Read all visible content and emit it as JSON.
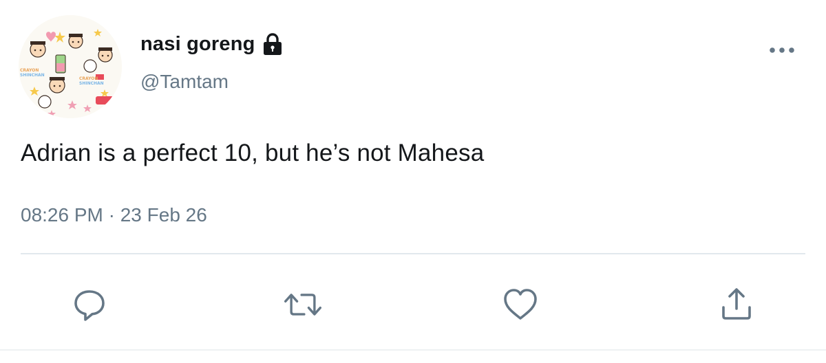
{
  "tweet": {
    "display_name": "nasi goreng",
    "handle": "@Tamtam",
    "text": "Adrian is a perfect 10, but he’s not Mahesa",
    "timestamp": "08:26 PM · 23 Feb 26",
    "protected": true
  },
  "avatar": {
    "texts": [
      "CRAYON",
      "SHINCHAN",
      "CRAYON",
      "SHINCHAN"
    ]
  },
  "icons": {
    "lock": "lock-icon",
    "more": "more-horizontal-icon",
    "reply": "reply-icon",
    "retweet": "retweet-icon",
    "like": "heart-icon",
    "share": "share-icon"
  },
  "colors": {
    "text_primary": "#14171a",
    "text_secondary": "#657786",
    "icon_gray": "#657786",
    "divider": "#e1e8ed"
  }
}
